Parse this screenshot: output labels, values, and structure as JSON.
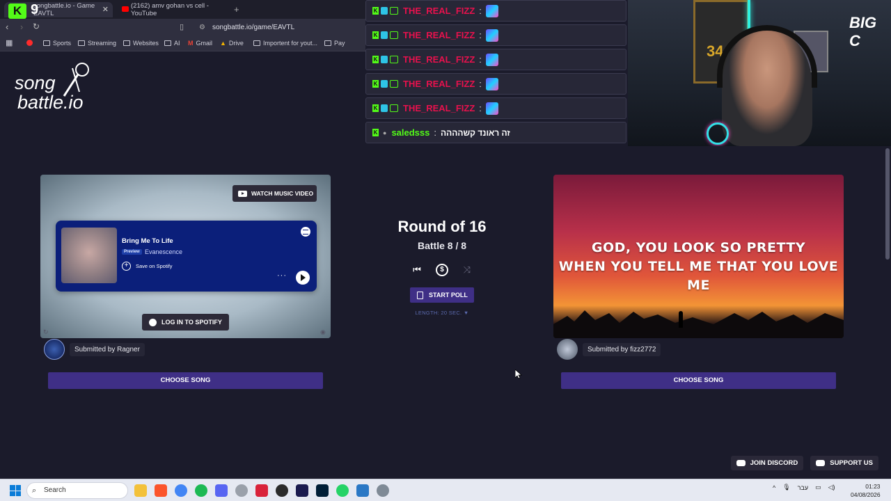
{
  "browser": {
    "tabs": [
      {
        "label": "songbattle.io - Game EAVTL",
        "active": true
      },
      {
        "label": "(2162) amv gohan vs cell - YouTube",
        "active": false
      }
    ],
    "kick_badge": "K",
    "kick_number": "9",
    "url": "songbattle.io/game/EAVTL",
    "bookmarks": [
      "Sports",
      "Streaming",
      "Websites",
      "AI",
      "Gmail",
      "Drive",
      "Importent for yout...",
      "Pay"
    ]
  },
  "site": {
    "logo_line1": "song",
    "logo_line2": "battle.io"
  },
  "chat": {
    "messages": [
      {
        "user": "THE_REAL_FIZZ",
        "message": ""
      },
      {
        "user": "THE_REAL_FIZZ",
        "message": ""
      },
      {
        "user": "THE_REAL_FIZZ",
        "message": ""
      },
      {
        "user": "THE_REAL_FIZZ",
        "message": ""
      },
      {
        "user": "THE_REAL_FIZZ",
        "message": ""
      },
      {
        "user": "saledsss",
        "message": "זה ראונד קשהההה"
      }
    ]
  },
  "webcam": {
    "jersey_number": "34",
    "overlay_logo": "BIG C"
  },
  "battle": {
    "round_title": "Round of 16",
    "battle_label": "Battle 8 / 8",
    "start_poll_label": "START POLL",
    "length_label": "LENGTH: 20 SEC. ▼"
  },
  "left_song": {
    "watch_video_label": "WATCH MUSIC VIDEO",
    "title": "Bring Me To Life",
    "preview_badge": "Preview",
    "artist": "Evanescence",
    "save_label": "Save on Spotify",
    "login_label": "LOG IN TO SPOTIFY",
    "submitted_by": "Submitted by Ragner",
    "choose_label": "CHOOSE SONG"
  },
  "right_song": {
    "lyric_line1": "GOD, YOU LOOK SO PRETTY",
    "lyric_line2": "WHEN YOU TELL ME THAT YOU LOVE ME",
    "submitted_by": "Submitted by fizz2772",
    "choose_label": "CHOOSE SONG"
  },
  "footer": {
    "discord_label": "JOIN DISCORD",
    "support_label": "SUPPORT US"
  },
  "taskbar": {
    "search_placeholder": "Search",
    "language": "עבר",
    "time": "01:23",
    "date": "04/08/2026"
  },
  "colors": {
    "background": "#1b1b2b",
    "accent_purple": "#3f2f86",
    "chat_name_red": "#e8114d",
    "kick_green": "#53fc18",
    "spotify_embed_blue": "#0b1f7a"
  }
}
